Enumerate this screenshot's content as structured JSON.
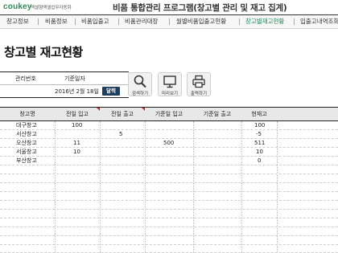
{
  "header": {
    "logo": "coukey",
    "logo_sub": "엑셀형맥셀업무자동화",
    "title": "비품 통합관리 프로그램(창고별 관리 및 재고 집계)"
  },
  "menu": {
    "items": [
      {
        "label": "창고정보",
        "active": false
      },
      {
        "label": "비품정보",
        "active": false
      },
      {
        "label": "비품입출고",
        "active": false
      },
      {
        "label": "비품관리대장",
        "active": false
      },
      {
        "label": "월별비품입출고현황",
        "active": false
      },
      {
        "label": "창고별재고현황",
        "active": true
      },
      {
        "label": "입출고내역조회",
        "active": false
      }
    ]
  },
  "page": {
    "title": "창고별 재고현황"
  },
  "controls": {
    "mgmt_no_label": "관리번호",
    "base_date_label": "기준일자",
    "base_date_value": "2016년 2월 18일",
    "calendar_label": "달력"
  },
  "actions": [
    {
      "label": "검색하기",
      "icon": "search-icon"
    },
    {
      "label": "미리보기",
      "icon": "monitor-icon"
    },
    {
      "label": "출력하기",
      "icon": "printer-icon"
    }
  ],
  "table": {
    "columns": [
      "창고명",
      "전일 입고",
      "전일 출고",
      "기준일 입고",
      "기준일 출고",
      "현재고"
    ],
    "rows": [
      {
        "name": "대구창고",
        "prev_in": "100",
        "prev_out": "",
        "base_in": "",
        "base_out": "",
        "stock": "100"
      },
      {
        "name": "서산창고",
        "prev_in": "",
        "prev_out": "5",
        "base_in": "",
        "base_out": "",
        "stock": "-5"
      },
      {
        "name": "오산창고",
        "prev_in": "11",
        "prev_out": "",
        "base_in": "500",
        "base_out": "",
        "stock": "511"
      },
      {
        "name": "서울창고",
        "prev_in": "10",
        "prev_out": "",
        "base_in": "",
        "base_out": "",
        "stock": "10"
      },
      {
        "name": "부산창고",
        "prev_in": "",
        "prev_out": "",
        "base_in": "",
        "base_out": "",
        "stock": "0"
      }
    ]
  },
  "colors": {
    "accent": "#1a8a5a",
    "calendar_button": "#1f3d5e",
    "header_marker": "#dd2222"
  }
}
